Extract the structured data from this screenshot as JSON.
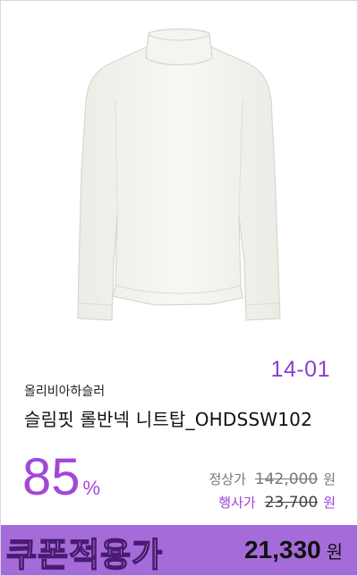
{
  "product": {
    "code": "14-01",
    "brand": "올리비아하슬러",
    "title": "슬림핏 롤반넥 니트탑_OHDSSW102",
    "image_icon": "sweater-image"
  },
  "pricing": {
    "discount_rate": "85",
    "percent_sign": "%",
    "normal_label": "정상가",
    "normal_price": "142,000",
    "sale_label": "행사가",
    "sale_price": "23,700",
    "currency": "원"
  },
  "coupon": {
    "label": "쿠폰적용가",
    "price": "21,330",
    "currency": "원"
  },
  "colors": {
    "accent_purple": "#a347d8",
    "coupon_bar": "#a56cd9",
    "code_purple": "#8a3fd0"
  }
}
